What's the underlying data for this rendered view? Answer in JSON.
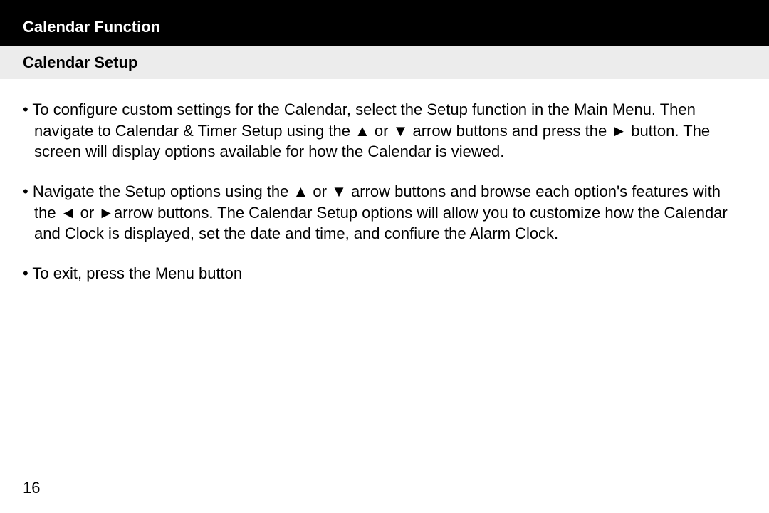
{
  "header": {
    "title": "Calendar Function"
  },
  "subheader": {
    "title": "Calendar Setup"
  },
  "bullets": [
    "• To configure custom settings for the Calendar, select the Setup function in the Main Menu.  Then navigate to Calendar & Timer Setup using the ▲ or ▼ arrow buttons and press the ► button.  The screen will display options available for how the Calendar is viewed.",
    "• Navigate the Setup options using the ▲ or ▼ arrow buttons and browse each option's features with the ◄ or ►arrow buttons.  The Calendar Setup options will allow you to customize how the Calendar and Clock is displayed, set the date and time, and confiure the Alarm Clock.",
    "• To exit, press the Menu button"
  ],
  "page_number": "16"
}
